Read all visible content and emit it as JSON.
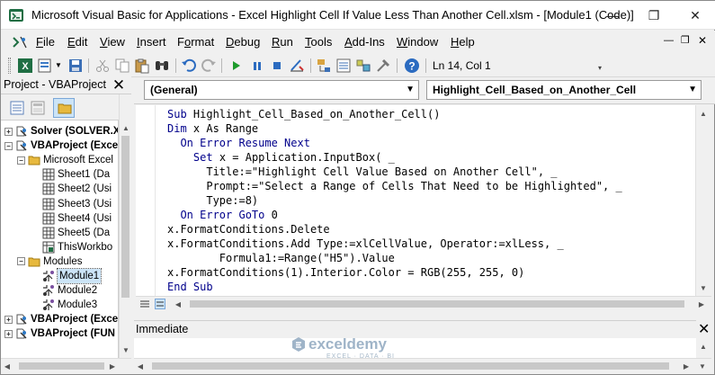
{
  "window": {
    "title": "Microsoft Visual Basic for Applications - Excel Highlight Cell If Value Less Than Another Cell.xlsm - [Module1 (Code)]",
    "minimize": "—",
    "restore": "❐",
    "close": "✕"
  },
  "menu": {
    "items": [
      {
        "pre": "",
        "ul": "F",
        "post": "ile"
      },
      {
        "pre": "",
        "ul": "E",
        "post": "dit"
      },
      {
        "pre": "",
        "ul": "V",
        "post": "iew"
      },
      {
        "pre": "",
        "ul": "I",
        "post": "nsert"
      },
      {
        "pre": "F",
        "ul": "o",
        "post": "rmat"
      },
      {
        "pre": "",
        "ul": "D",
        "post": "ebug"
      },
      {
        "pre": "",
        "ul": "R",
        "post": "un"
      },
      {
        "pre": "",
        "ul": "T",
        "post": "ools"
      },
      {
        "pre": "",
        "ul": "A",
        "post": "dd-Ins"
      },
      {
        "pre": "",
        "ul": "W",
        "post": "indow"
      },
      {
        "pre": "",
        "ul": "H",
        "post": "elp"
      }
    ],
    "doc_min": "—",
    "doc_restore": "❐",
    "doc_close": "✕"
  },
  "toolbar": {
    "cursor_position": "Ln 14, Col 1"
  },
  "project": {
    "title": "Project - VBAProject",
    "close": "✕",
    "tree": [
      {
        "label": "Solver (SOLVER.X",
        "bold": true,
        "level": 0,
        "exp": "+",
        "icon": "project-icon"
      },
      {
        "label": "VBAProject (Exce",
        "bold": true,
        "level": 0,
        "exp": "−",
        "icon": "project-icon"
      },
      {
        "label": "Microsoft Excel",
        "bold": false,
        "level": 1,
        "exp": "−",
        "icon": "folder-icon"
      },
      {
        "label": "Sheet1 (Da",
        "bold": false,
        "level": 2,
        "exp": "",
        "icon": "sheet-icon"
      },
      {
        "label": "Sheet2 (Usi",
        "bold": false,
        "level": 2,
        "exp": "",
        "icon": "sheet-icon"
      },
      {
        "label": "Sheet3 (Usi",
        "bold": false,
        "level": 2,
        "exp": "",
        "icon": "sheet-icon"
      },
      {
        "label": "Sheet4 (Usi",
        "bold": false,
        "level": 2,
        "exp": "",
        "icon": "sheet-icon"
      },
      {
        "label": "Sheet5 (Da",
        "bold": false,
        "level": 2,
        "exp": "",
        "icon": "sheet-icon"
      },
      {
        "label": "ThisWorkbo",
        "bold": false,
        "level": 2,
        "exp": "",
        "icon": "workbook-icon"
      },
      {
        "label": "Modules",
        "bold": false,
        "level": 1,
        "exp": "−",
        "icon": "folder-icon"
      },
      {
        "label": "Module1",
        "bold": false,
        "level": 2,
        "exp": "",
        "icon": "module-icon",
        "selected": true
      },
      {
        "label": "Module2",
        "bold": false,
        "level": 2,
        "exp": "",
        "icon": "module-icon"
      },
      {
        "label": "Module3",
        "bold": false,
        "level": 2,
        "exp": "",
        "icon": "module-icon"
      },
      {
        "label": "VBAProject (Exce",
        "bold": true,
        "level": 0,
        "exp": "+",
        "icon": "project-icon"
      },
      {
        "label": "VBAProject (FUN",
        "bold": true,
        "level": 0,
        "exp": "+",
        "icon": "project-icon"
      }
    ]
  },
  "code": {
    "object_combo": "(General)",
    "procedure_combo": "Highlight_Cell_Based_on_Another_Cell",
    "lines": [
      {
        "indent": "",
        "kw": "Sub",
        "rest": " Highlight_Cell_Based_on_Another_Cell()"
      },
      {
        "indent": "",
        "kw": "Dim",
        "rest": " x As Range"
      },
      {
        "indent": "  ",
        "kw": "On Error Resume Next",
        "rest": ""
      },
      {
        "indent": "    ",
        "kw": "Set",
        "rest": " x = Application.InputBox( _"
      },
      {
        "indent": "      ",
        "kw": "",
        "rest": "Title:=\"Highlight Cell Value Based on Another Cell\", _"
      },
      {
        "indent": "      ",
        "kw": "",
        "rest": "Prompt:=\"Select a Range of Cells That Need to be Highlighted\", _"
      },
      {
        "indent": "      ",
        "kw": "",
        "rest": "Type:=8)"
      },
      {
        "indent": "  ",
        "kw": "On Error GoTo",
        "rest": " 0"
      },
      {
        "indent": "",
        "kw": "",
        "rest": "x.FormatConditions.Delete"
      },
      {
        "indent": "",
        "kw": "",
        "rest": "x.FormatConditions.Add Type:=xlCellValue, Operator:=xlLess, _"
      },
      {
        "indent": "        ",
        "kw": "",
        "rest": "Formula1:=Range(\"H5\").Value"
      },
      {
        "indent": "",
        "kw": "",
        "rest": "x.FormatConditions(1).Interior.Color = RGB(255, 255, 0)"
      },
      {
        "indent": "",
        "kw": "End Sub",
        "rest": ""
      }
    ]
  },
  "immediate": {
    "title": "Immediate",
    "close": "✕"
  },
  "watermark": {
    "brand": "exceldemy",
    "tagline": "EXCEL · DATA · BI"
  },
  "colors": {
    "keyword": "#00008b",
    "selection": "#cce4f7"
  }
}
